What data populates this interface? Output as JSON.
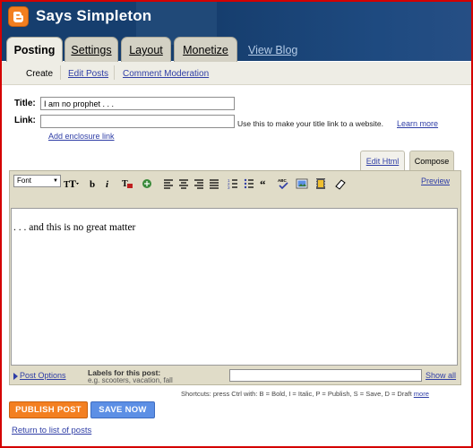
{
  "header": {
    "blog_title": "Says Simpleton",
    "tabs": [
      {
        "label": "Posting",
        "active": true
      },
      {
        "label": "Settings",
        "active": false
      },
      {
        "label": "Layout",
        "active": false
      },
      {
        "label": "Monetize",
        "active": false
      }
    ],
    "view_blog": "View Blog"
  },
  "subtabs": [
    {
      "label": "Create",
      "active": true
    },
    {
      "label": "Edit Posts",
      "active": false
    },
    {
      "label": "Comment Moderation",
      "active": false
    }
  ],
  "form": {
    "title_label": "Title:",
    "title_value": "I am no prophet . . .",
    "link_label": "Link:",
    "link_value": "",
    "link_hint": "Use this to make your title link to a website.",
    "learn_more": "Learn more",
    "enclosure": "Add enclosure link"
  },
  "editor": {
    "tab_edit_html": "Edit Html",
    "tab_compose": "Compose",
    "font_select": "Font",
    "preview": "Preview",
    "body": ". . . and this is no great matter"
  },
  "labels": {
    "post_options": "Post Options",
    "title": "Labels for this post:",
    "example": "e.g. scooters, vacation, fall",
    "show_all": "Show all"
  },
  "shortcuts": {
    "text": "Shortcuts: press Ctrl with: B = Bold, I = Italic, P = Publish, S = Save, D = Draft",
    "more": "more"
  },
  "buttons": {
    "publish": "PUBLISH POST",
    "save": "SAVE NOW"
  },
  "return_link": "Return to list of posts",
  "colors": {
    "header_bg": "#163e6e",
    "publish": "#f37f20",
    "save": "#5c8fe5",
    "link": "#2f3ea6",
    "border": "#d40000"
  }
}
